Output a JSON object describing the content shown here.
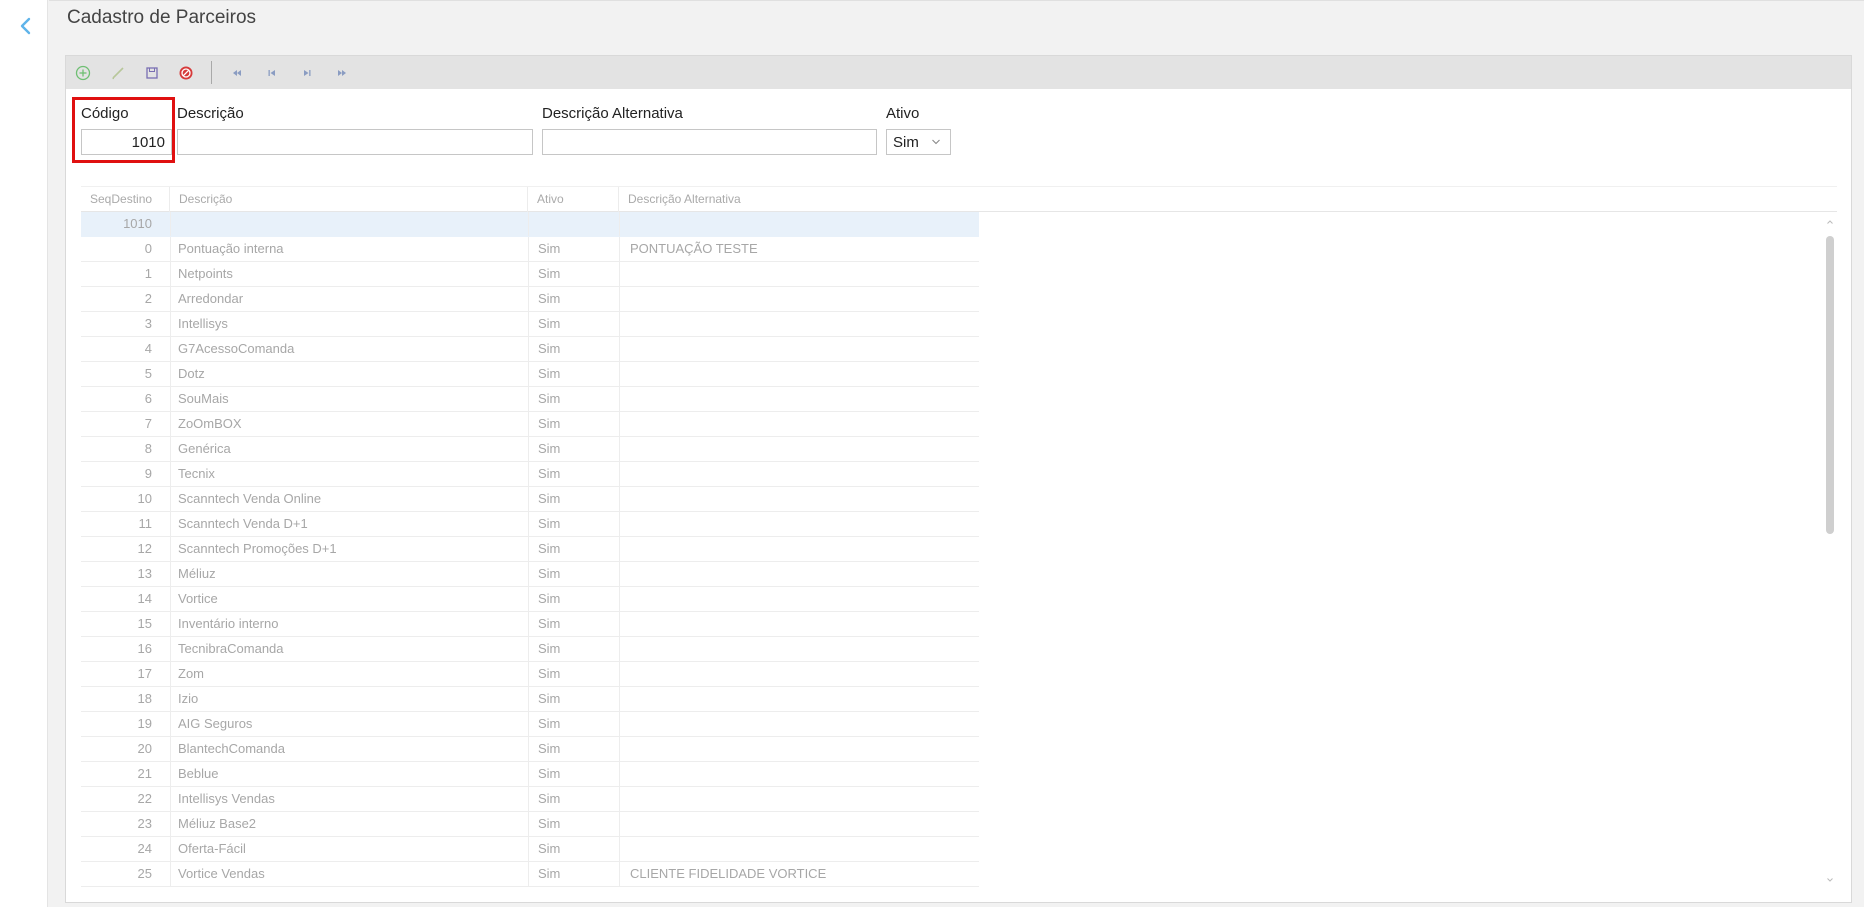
{
  "page": {
    "title": "Cadastro de Parceiros"
  },
  "form": {
    "codigo_label": "Código",
    "codigo_value": "1010",
    "descricao_label": "Descrição",
    "descricao_value": "",
    "descricao_alt_label": "Descrição Alternativa",
    "descricao_alt_value": "",
    "ativo_label": "Ativo",
    "ativo_value": "Sim"
  },
  "toolbar": {
    "buttons": [
      "add-icon",
      "edit-icon",
      "save-icon",
      "cancel-icon",
      "first-record-icon",
      "previous-record-icon",
      "next-record-icon",
      "last-record-icon"
    ]
  },
  "grid": {
    "columns": [
      "SeqDestino",
      "Descrição",
      "Ativo",
      "Descrição Alternativa"
    ],
    "rows": [
      {
        "seq": "1010",
        "desc": "",
        "ativo": "",
        "alt": ""
      },
      {
        "seq": "0",
        "desc": "Pontuação interna",
        "ativo": "Sim",
        "alt": "PONTUAÇÃO TESTE"
      },
      {
        "seq": "1",
        "desc": "Netpoints",
        "ativo": "Sim",
        "alt": ""
      },
      {
        "seq": "2",
        "desc": "Arredondar",
        "ativo": "Sim",
        "alt": ""
      },
      {
        "seq": "3",
        "desc": "Intellisys",
        "ativo": "Sim",
        "alt": ""
      },
      {
        "seq": "4",
        "desc": "G7AcessoComanda",
        "ativo": "Sim",
        "alt": ""
      },
      {
        "seq": "5",
        "desc": "Dotz",
        "ativo": "Sim",
        "alt": ""
      },
      {
        "seq": "6",
        "desc": "SouMais",
        "ativo": "Sim",
        "alt": ""
      },
      {
        "seq": "7",
        "desc": "ZoOmBOX",
        "ativo": "Sim",
        "alt": ""
      },
      {
        "seq": "8",
        "desc": "Genérica",
        "ativo": "Sim",
        "alt": ""
      },
      {
        "seq": "9",
        "desc": "Tecnix",
        "ativo": "Sim",
        "alt": ""
      },
      {
        "seq": "10",
        "desc": "Scanntech Venda Online",
        "ativo": "Sim",
        "alt": ""
      },
      {
        "seq": "11",
        "desc": "Scanntech Venda D+1",
        "ativo": "Sim",
        "alt": ""
      },
      {
        "seq": "12",
        "desc": "Scanntech Promoções D+1",
        "ativo": "Sim",
        "alt": ""
      },
      {
        "seq": "13",
        "desc": "Méliuz",
        "ativo": "Sim",
        "alt": ""
      },
      {
        "seq": "14",
        "desc": "Vortice",
        "ativo": "Sim",
        "alt": ""
      },
      {
        "seq": "15",
        "desc": "Inventário interno",
        "ativo": "Sim",
        "alt": ""
      },
      {
        "seq": "16",
        "desc": "TecnibraComanda",
        "ativo": "Sim",
        "alt": ""
      },
      {
        "seq": "17",
        "desc": "Zom",
        "ativo": "Sim",
        "alt": ""
      },
      {
        "seq": "18",
        "desc": "Izio",
        "ativo": "Sim",
        "alt": ""
      },
      {
        "seq": "19",
        "desc": "AIG Seguros",
        "ativo": "Sim",
        "alt": ""
      },
      {
        "seq": "20",
        "desc": "BlantechComanda",
        "ativo": "Sim",
        "alt": ""
      },
      {
        "seq": "21",
        "desc": "Beblue",
        "ativo": "Sim",
        "alt": ""
      },
      {
        "seq": "22",
        "desc": "Intellisys Vendas",
        "ativo": "Sim",
        "alt": ""
      },
      {
        "seq": "23",
        "desc": "Méliuz Base2",
        "ativo": "Sim",
        "alt": ""
      },
      {
        "seq": "24",
        "desc": "Oferta-Fácil",
        "ativo": "Sim",
        "alt": ""
      },
      {
        "seq": "25",
        "desc": "Vortice Vendas",
        "ativo": "Sim",
        "alt": "CLIENTE FIDELIDADE VORTICE"
      }
    ]
  },
  "colors": {
    "highlight": "#e01010",
    "selected_row": "#e8f1fa",
    "add": "#6fbf73",
    "cancel": "#d63a3a",
    "nav": "#8a9cc2"
  }
}
